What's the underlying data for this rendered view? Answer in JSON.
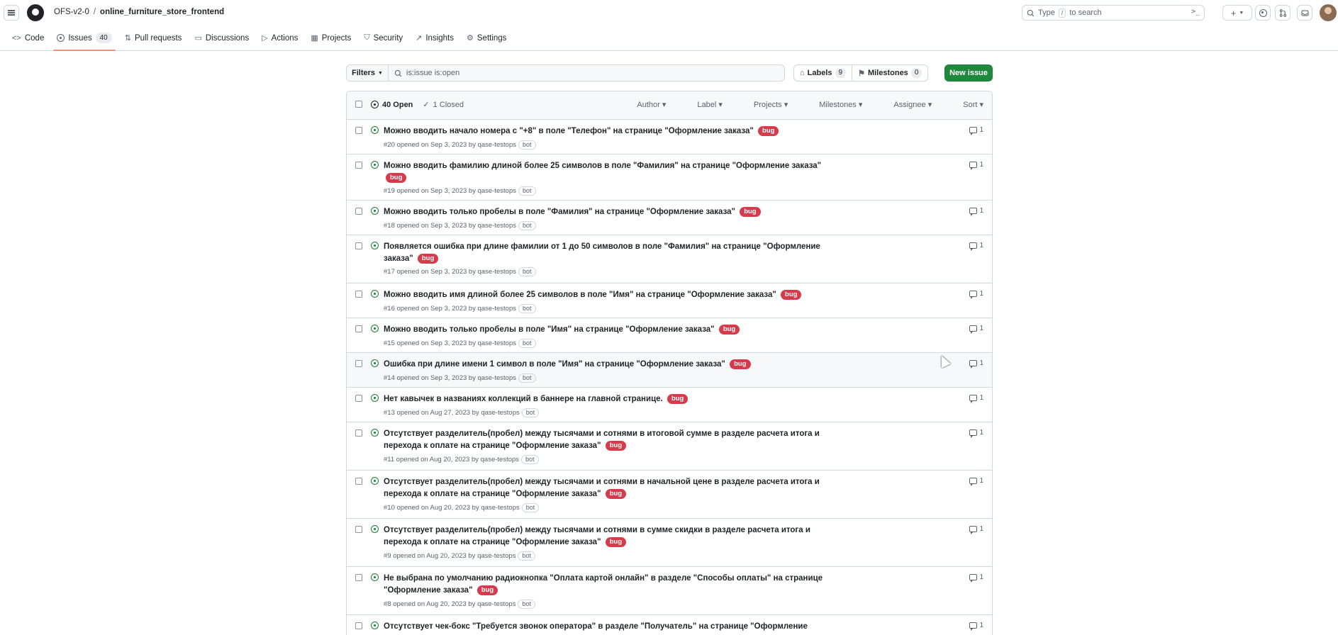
{
  "header": {
    "owner": "OFS-v2-0",
    "separator": "/",
    "repo": "online_furniture_store_frontend",
    "search_placeholder_prefix": "Type",
    "search_key": "/",
    "search_placeholder_suffix": "to search",
    "plus_label": "+",
    "icons": [
      "menu-icon",
      "github-logo",
      "terminal-icon",
      "plus-icon",
      "issue-icon",
      "pull-request-icon",
      "inbox-icon",
      "avatar"
    ]
  },
  "nav": {
    "tabs": [
      {
        "label": "Code",
        "icon": "code-icon"
      },
      {
        "label": "Issues",
        "icon": "issue-opened-icon",
        "counter": "40",
        "active": true
      },
      {
        "label": "Pull requests",
        "icon": "git-pull-request-icon"
      },
      {
        "label": "Discussions",
        "icon": "comment-discussion-icon"
      },
      {
        "label": "Actions",
        "icon": "play-icon"
      },
      {
        "label": "Projects",
        "icon": "table-icon"
      },
      {
        "label": "Security",
        "icon": "shield-icon"
      },
      {
        "label": "Insights",
        "icon": "graph-icon"
      },
      {
        "label": "Settings",
        "icon": "gear-icon"
      }
    ]
  },
  "toolbar": {
    "filters_label": "Filters",
    "search_value": "is:issue is:open",
    "labels_label": "Labels",
    "labels_count": "9",
    "milestones_label": "Milestones",
    "milestones_count": "0",
    "new_issue_label": "New issue"
  },
  "list_header": {
    "open_label": "40 Open",
    "closed_label": "1 Closed",
    "sorters": [
      "Author",
      "Label",
      "Projects",
      "Milestones",
      "Assignee",
      "Sort"
    ]
  },
  "colors": {
    "open_green": "#1a7f37",
    "bug_red": "#d73a4a",
    "new_issue_green": "#1f883d",
    "tab_underline": "#fd8c73"
  },
  "issues": [
    {
      "title": "Можно вводить начало номера с \"+8\" в поле \"Телефон\" на странице \"Оформление заказа\"",
      "label": "bug",
      "meta": "#20 opened on Sep 3, 2023 by qase-testops",
      "badge": "bot",
      "comments": "1"
    },
    {
      "title": "Можно вводить фамилию длиной более 25 символов в поле \"Фамилия\" на странице \"Оформление заказа\"",
      "label": "bug",
      "meta": "#19 opened on Sep 3, 2023 by qase-testops",
      "badge": "bot",
      "comments": "1"
    },
    {
      "title": "Можно вводить только пробелы в поле \"Фамилия\" на странице \"Оформление заказа\"",
      "label": "bug",
      "meta": "#18 opened on Sep 3, 2023 by qase-testops",
      "badge": "bot",
      "comments": "1"
    },
    {
      "title": "Появляется ошибка при длине фамилии от 1 до 50 символов в поле \"Фамилия\" на странице \"Оформление заказа\"",
      "label": "bug",
      "meta": "#17 opened on Sep 3, 2023 by qase-testops",
      "badge": "bot",
      "comments": "1"
    },
    {
      "title": "Можно вводить имя длиной более 25 символов в поле \"Имя\" на странице \"Оформление заказа\"",
      "label": "bug",
      "meta": "#16 opened on Sep 3, 2023 by qase-testops",
      "badge": "bot",
      "comments": "1"
    },
    {
      "title": "Можно вводить только пробелы в поле \"Имя\" на странице \"Оформление заказа\"",
      "label": "bug",
      "meta": "#15 opened on Sep 3, 2023 by qase-testops",
      "badge": "bot",
      "comments": "1"
    },
    {
      "title": "Ошибка при длине имени 1 символ в поле \"Имя\" на странице \"Оформление заказа\"",
      "label": "bug",
      "meta": "#14 opened on Sep 3, 2023 by qase-testops",
      "badge": "bot",
      "comments": "1"
    },
    {
      "title": "Нет кавычек в названиях коллекций в баннере на главной странице.",
      "label": "bug",
      "meta": "#13 opened on Aug 27, 2023 by qase-testops",
      "badge": "bot",
      "comments": "1"
    },
    {
      "title": "Отсутствует разделитель(пробел) между тысячами и сотнями в итоговой сумме в разделе расчета итога и перехода к оплате на странице \"Оформление заказа\"",
      "label": "bug",
      "meta": "#11 opened on Aug 20, 2023 by qase-testops",
      "badge": "bot",
      "comments": "1"
    },
    {
      "title": "Отсутствует разделитель(пробел) между тысячами и сотнями в начальной цене в разделе расчета итога и перехода к оплате на странице \"Оформление заказа\"",
      "label": "bug",
      "meta": "#10 opened on Aug 20, 2023 by qase-testops",
      "badge": "bot",
      "comments": "1"
    },
    {
      "title": "Отсутствует разделитель(пробел) между тысячами и сотнями в сумме скидки в разделе расчета итога и перехода к оплате на странице \"Оформление заказа\"",
      "label": "bug",
      "meta": "#9 opened on Aug 20, 2023 by qase-testops",
      "badge": "bot",
      "comments": "1"
    },
    {
      "title": "Не выбрана по умолчанию радиокнопка \"Оплата картой онлайн\" в разделе \"Способы оплаты\" на странице \"Оформление заказа\"",
      "label": "bug",
      "meta": "#8 opened on Aug 20, 2023 by qase-testops",
      "badge": "bot",
      "comments": "1"
    },
    {
      "title": "Отсутствует чек-бокс \"Требуется звонок оператора\" в разделе \"Получатель\" на странице \"Оформление",
      "label": "",
      "meta": "",
      "badge": "",
      "comments": "1"
    }
  ]
}
